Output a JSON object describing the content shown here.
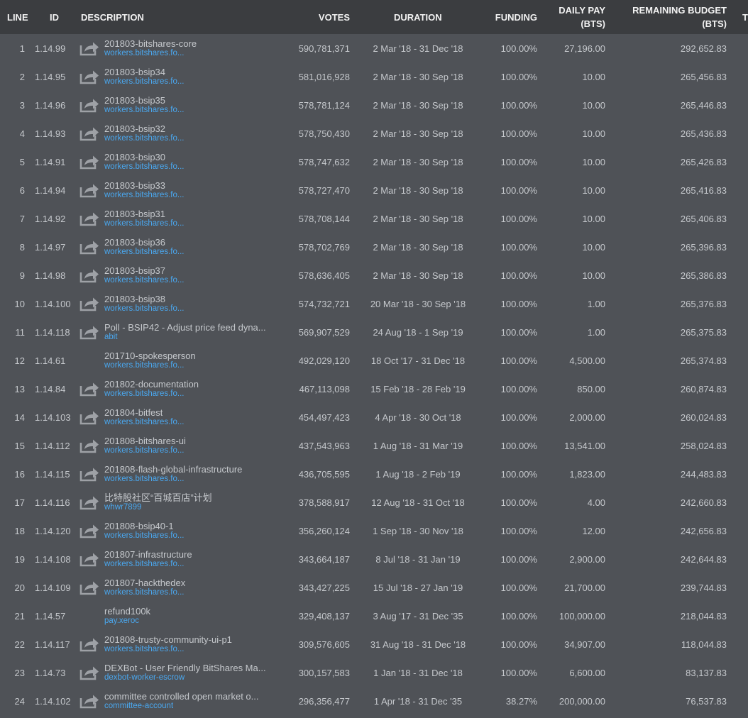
{
  "columns": {
    "line": "LINE",
    "id": "ID",
    "description": "DESCRIPTION",
    "votes": "VOTES",
    "duration": "DURATION",
    "funding": "FUNDING",
    "daily_pay_1": "DAILY PAY",
    "daily_pay_2": "(BTS)",
    "remaining_1": "REMAINING BUDGET",
    "remaining_2": "(BTS)",
    "extra": "T"
  },
  "rows": [
    {
      "line": "1",
      "id": "1.14.99",
      "icon": true,
      "name": "201803-bitshares-core",
      "link": "workers.bitshares.fo...",
      "votes": "590,781,371",
      "duration": "2 Mar '18 - 31 Dec '18",
      "funding": "100.00%",
      "daily_pay": "27,196.00",
      "remaining": "292,652.83"
    },
    {
      "line": "2",
      "id": "1.14.95",
      "icon": true,
      "name": "201803-bsip34",
      "link": "workers.bitshares.fo...",
      "votes": "581,016,928",
      "duration": "2 Mar '18 - 30 Sep '18",
      "funding": "100.00%",
      "daily_pay": "10.00",
      "remaining": "265,456.83"
    },
    {
      "line": "3",
      "id": "1.14.96",
      "icon": true,
      "name": "201803-bsip35",
      "link": "workers.bitshares.fo...",
      "votes": "578,781,124",
      "duration": "2 Mar '18 - 30 Sep '18",
      "funding": "100.00%",
      "daily_pay": "10.00",
      "remaining": "265,446.83"
    },
    {
      "line": "4",
      "id": "1.14.93",
      "icon": true,
      "name": "201803-bsip32",
      "link": "workers.bitshares.fo...",
      "votes": "578,750,430",
      "duration": "2 Mar '18 - 30 Sep '18",
      "funding": "100.00%",
      "daily_pay": "10.00",
      "remaining": "265,436.83"
    },
    {
      "line": "5",
      "id": "1.14.91",
      "icon": true,
      "name": "201803-bsip30",
      "link": "workers.bitshares.fo...",
      "votes": "578,747,632",
      "duration": "2 Mar '18 - 30 Sep '18",
      "funding": "100.00%",
      "daily_pay": "10.00",
      "remaining": "265,426.83"
    },
    {
      "line": "6",
      "id": "1.14.94",
      "icon": true,
      "name": "201803-bsip33",
      "link": "workers.bitshares.fo...",
      "votes": "578,727,470",
      "duration": "2 Mar '18 - 30 Sep '18",
      "funding": "100.00%",
      "daily_pay": "10.00",
      "remaining": "265,416.83"
    },
    {
      "line": "7",
      "id": "1.14.92",
      "icon": true,
      "name": "201803-bsip31",
      "link": "workers.bitshares.fo...",
      "votes": "578,708,144",
      "duration": "2 Mar '18 - 30 Sep '18",
      "funding": "100.00%",
      "daily_pay": "10.00",
      "remaining": "265,406.83"
    },
    {
      "line": "8",
      "id": "1.14.97",
      "icon": true,
      "name": "201803-bsip36",
      "link": "workers.bitshares.fo...",
      "votes": "578,702,769",
      "duration": "2 Mar '18 - 30 Sep '18",
      "funding": "100.00%",
      "daily_pay": "10.00",
      "remaining": "265,396.83"
    },
    {
      "line": "9",
      "id": "1.14.98",
      "icon": true,
      "name": "201803-bsip37",
      "link": "workers.bitshares.fo...",
      "votes": "578,636,405",
      "duration": "2 Mar '18 - 30 Sep '18",
      "funding": "100.00%",
      "daily_pay": "10.00",
      "remaining": "265,386.83"
    },
    {
      "line": "10",
      "id": "1.14.100",
      "icon": true,
      "name": "201803-bsip38",
      "link": "workers.bitshares.fo...",
      "votes": "574,732,721",
      "duration": "20 Mar '18 - 30 Sep '18",
      "funding": "100.00%",
      "daily_pay": "1.00",
      "remaining": "265,376.83"
    },
    {
      "line": "11",
      "id": "1.14.118",
      "icon": true,
      "name": "Poll - BSIP42 - Adjust price feed dyna...",
      "link": "abit",
      "votes": "569,907,529",
      "duration": "24 Aug '18 - 1 Sep '19",
      "funding": "100.00%",
      "daily_pay": "1.00",
      "remaining": "265,375.83"
    },
    {
      "line": "12",
      "id": "1.14.61",
      "icon": false,
      "name": "201710-spokesperson",
      "link": "workers.bitshares.fo...",
      "votes": "492,029,120",
      "duration": "18 Oct '17 - 31 Dec '18",
      "funding": "100.00%",
      "daily_pay": "4,500.00",
      "remaining": "265,374.83"
    },
    {
      "line": "13",
      "id": "1.14.84",
      "icon": true,
      "name": "201802-documentation",
      "link": "workers.bitshares.fo...",
      "votes": "467,113,098",
      "duration": "15 Feb '18 - 28 Feb '19",
      "funding": "100.00%",
      "daily_pay": "850.00",
      "remaining": "260,874.83"
    },
    {
      "line": "14",
      "id": "1.14.103",
      "icon": true,
      "name": "201804-bitfest",
      "link": "workers.bitshares.fo...",
      "votes": "454,497,423",
      "duration": "4 Apr '18 - 30 Oct '18",
      "funding": "100.00%",
      "daily_pay": "2,000.00",
      "remaining": "260,024.83"
    },
    {
      "line": "15",
      "id": "1.14.112",
      "icon": true,
      "name": "201808-bitshares-ui",
      "link": "workers.bitshares.fo...",
      "votes": "437,543,963",
      "duration": "1 Aug '18 - 31 Mar '19",
      "funding": "100.00%",
      "daily_pay": "13,541.00",
      "remaining": "258,024.83"
    },
    {
      "line": "16",
      "id": "1.14.115",
      "icon": true,
      "name": "201808-flash-global-infrastructure",
      "link": "workers.bitshares.fo...",
      "votes": "436,705,595",
      "duration": "1 Aug '18 - 2 Feb '19",
      "funding": "100.00%",
      "daily_pay": "1,823.00",
      "remaining": "244,483.83"
    },
    {
      "line": "17",
      "id": "1.14.116",
      "icon": true,
      "name": "比特股社区“百城百店”计划",
      "link": "whwr7899",
      "votes": "378,588,917",
      "duration": "12 Aug '18 - 31 Oct '18",
      "funding": "100.00%",
      "daily_pay": "4.00",
      "remaining": "242,660.83"
    },
    {
      "line": "18",
      "id": "1.14.120",
      "icon": true,
      "name": "201808-bsip40-1",
      "link": "workers.bitshares.fo...",
      "votes": "356,260,124",
      "duration": "1 Sep '18 - 30 Nov '18",
      "funding": "100.00%",
      "daily_pay": "12.00",
      "remaining": "242,656.83"
    },
    {
      "line": "19",
      "id": "1.14.108",
      "icon": true,
      "name": "201807-infrastructure",
      "link": "workers.bitshares.fo...",
      "votes": "343,664,187",
      "duration": "8 Jul '18 - 31 Jan '19",
      "funding": "100.00%",
      "daily_pay": "2,900.00",
      "remaining": "242,644.83"
    },
    {
      "line": "20",
      "id": "1.14.109",
      "icon": true,
      "name": "201807-hackthedex",
      "link": "workers.bitshares.fo...",
      "votes": "343,427,225",
      "duration": "15 Jul '18 - 27 Jan '19",
      "funding": "100.00%",
      "daily_pay": "21,700.00",
      "remaining": "239,744.83"
    },
    {
      "line": "21",
      "id": "1.14.57",
      "icon": false,
      "name": "refund100k",
      "link": "pay.xeroc",
      "votes": "329,408,137",
      "duration": "3 Aug '17 - 31 Dec '35",
      "funding": "100.00%",
      "daily_pay": "100,000.00",
      "remaining": "218,044.83"
    },
    {
      "line": "22",
      "id": "1.14.117",
      "icon": true,
      "name": "201808-trusty-community-ui-p1",
      "link": "workers.bitshares.fo...",
      "votes": "309,576,605",
      "duration": "31 Aug '18 - 31 Dec '18",
      "funding": "100.00%",
      "daily_pay": "34,907.00",
      "remaining": "118,044.83"
    },
    {
      "line": "23",
      "id": "1.14.73",
      "icon": true,
      "name": "DEXBot - User Friendly BitShares Ma...",
      "link": "dexbot-worker-escrow",
      "votes": "300,157,583",
      "duration": "1 Jan '18 - 31 Dec '18",
      "funding": "100.00%",
      "daily_pay": "6,600.00",
      "remaining": "83,137.83"
    },
    {
      "line": "24",
      "id": "1.14.102",
      "icon": true,
      "name": "committee controlled open market o...",
      "link": "committee-account",
      "votes": "296,356,477",
      "duration": "1 Apr '18 - 31 Dec '35",
      "funding": "38.27%",
      "daily_pay": "200,000.00",
      "remaining": "76,537.83"
    }
  ],
  "colors": {
    "background": "#4f5257",
    "header": "#3b3d40",
    "link": "#4aa8f0",
    "text": "#c5c8cc"
  }
}
